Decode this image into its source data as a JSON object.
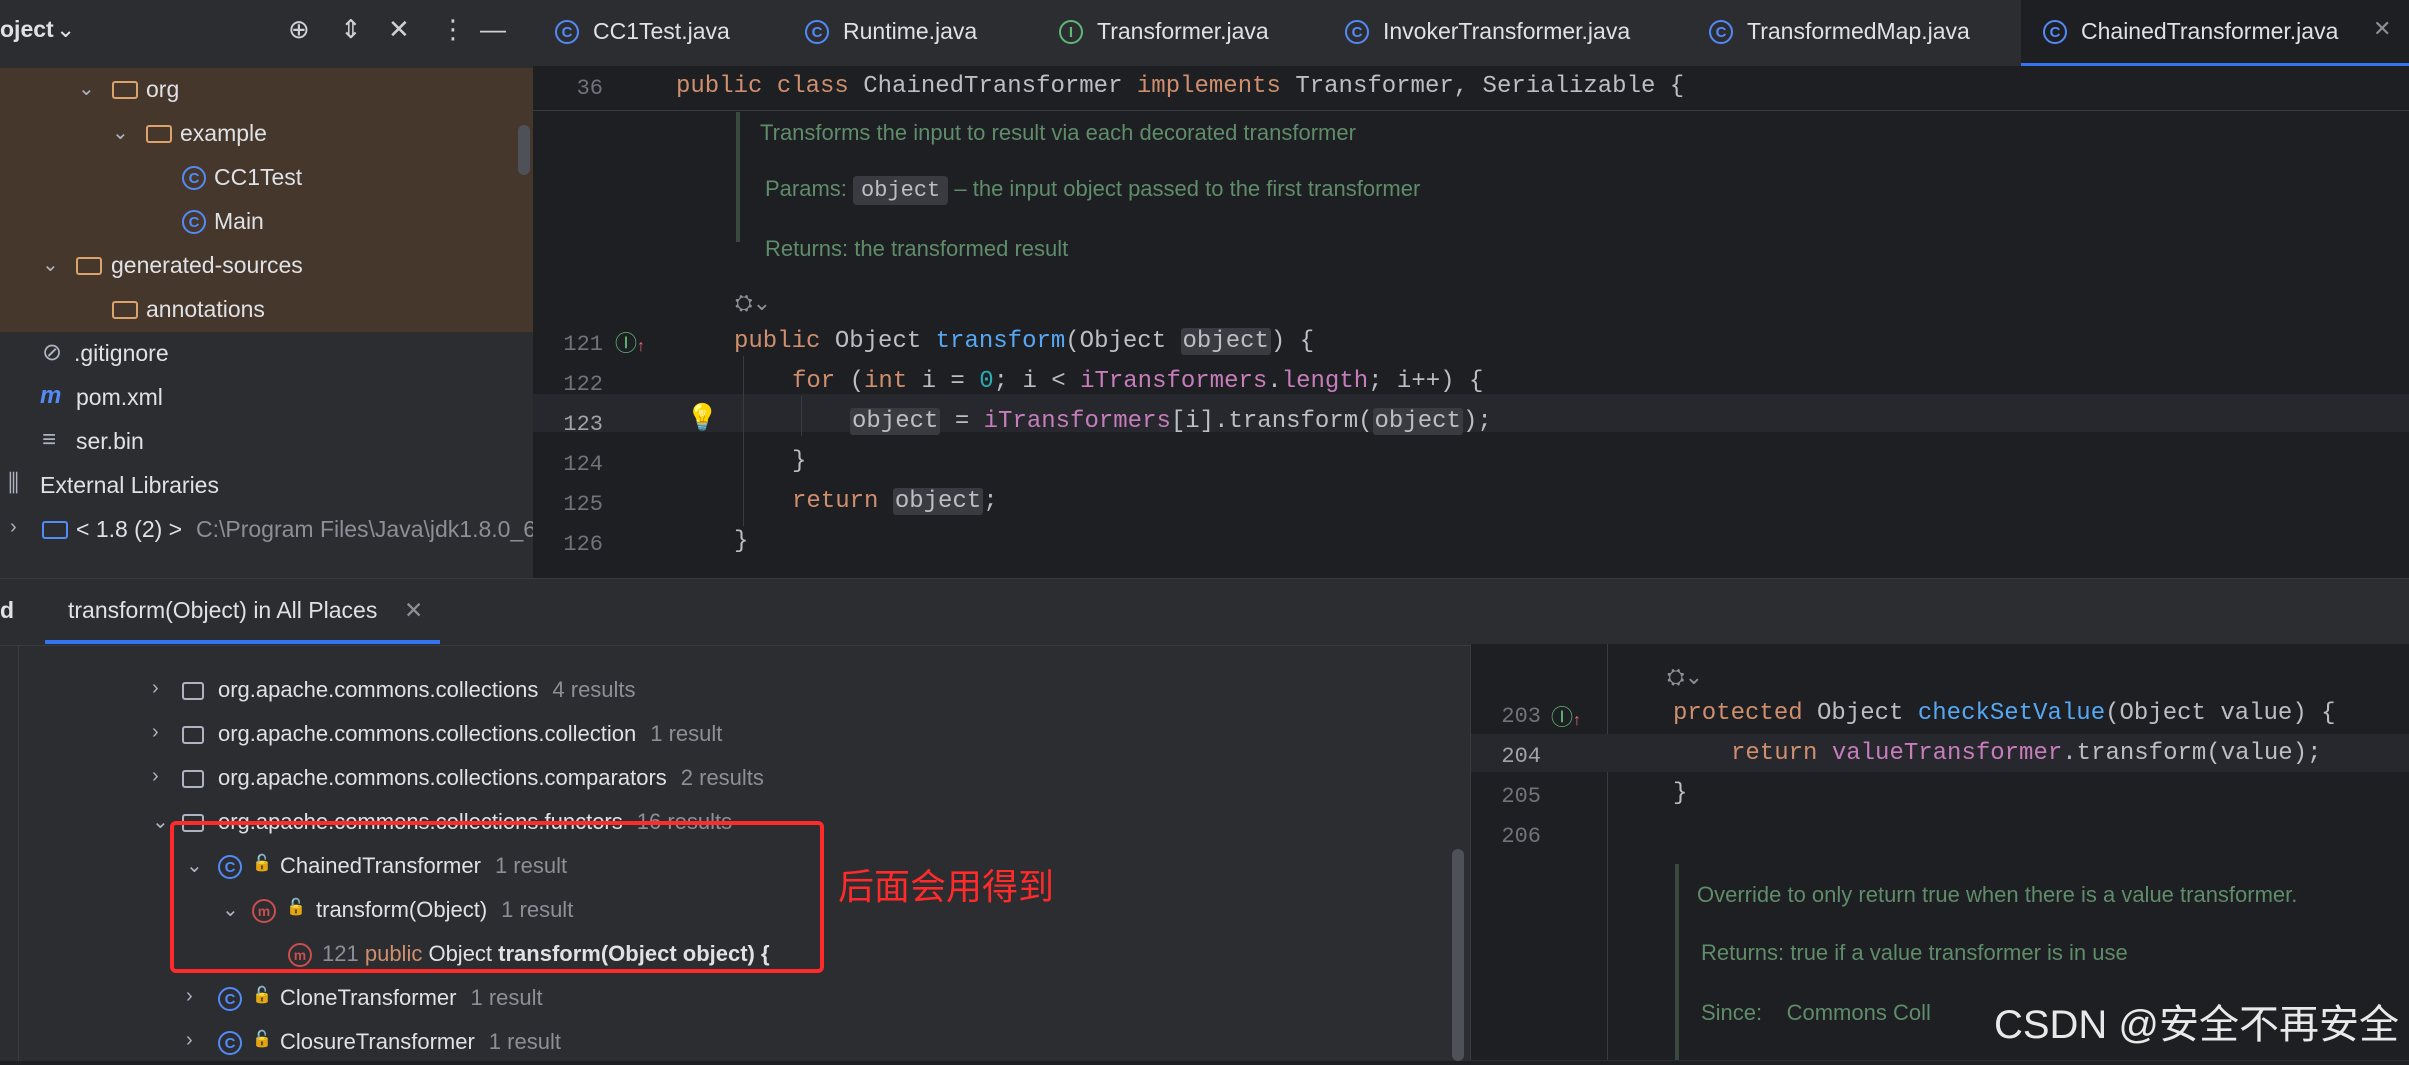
{
  "project": {
    "title": "oject",
    "tree": [
      {
        "label": "org"
      },
      {
        "label": "example"
      },
      {
        "label": "CC1Test"
      },
      {
        "label": "Main"
      },
      {
        "label": "generated-sources"
      },
      {
        "label": "annotations"
      },
      {
        "label": ".gitignore"
      },
      {
        "label": "pom.xml"
      },
      {
        "label": "ser.bin"
      },
      {
        "label": "External Libraries"
      },
      {
        "label": "< 1.8 (2) >",
        "path": "C:\\Program Files\\Java\\jdk1.8.0_6"
      }
    ]
  },
  "tabs": [
    {
      "label": "CC1Test.java",
      "icon": "C"
    },
    {
      "label": "Runtime.java",
      "icon": "C"
    },
    {
      "label": "Transformer.java",
      "icon": "I"
    },
    {
      "label": "InvokerTransformer.java",
      "icon": "C"
    },
    {
      "label": "TransformedMap.java",
      "icon": "C"
    },
    {
      "label": "ChainedTransformer.java",
      "icon": "C"
    }
  ],
  "editor": {
    "line36": "36",
    "class_decl": {
      "kw1": "public class ",
      "name": "ChainedTransformer ",
      "kw2": "implements ",
      "rest": "Transformer, Serializable {"
    },
    "doc": {
      "summary": "Transforms the input to result via each decorated transformer",
      "params_label": "Params:",
      "params_chip": "object",
      "params_text": "– the input object passed to the first transformer",
      "returns": "Returns: the transformed result"
    },
    "lines": [
      {
        "num": "121"
      },
      {
        "num": "122"
      },
      {
        "num": "123"
      },
      {
        "num": "124"
      },
      {
        "num": "125"
      },
      {
        "num": "126"
      }
    ],
    "code": {
      "l121_kw": "public ",
      "l121_ty": "Object ",
      "l121_fn": "transform",
      "l121_p1": "(Object ",
      "l121_var": "object",
      "l121_end": ") {",
      "l122_kw": "for ",
      "l122_a": "(",
      "l122_int": "int ",
      "l122_b": "i = ",
      "l122_zero": "0",
      "l122_c": "; i < ",
      "l122_fld": "iTransformers",
      "l122_d": ".",
      "l122_len": "length",
      "l122_e": "; i++) {",
      "l123_var": "object",
      "l123_a": " = ",
      "l123_fld": "iTransformers",
      "l123_b": "[i].transform(",
      "l123_var2": "object",
      "l123_c": ");",
      "l124": "}",
      "l125_kw": "return ",
      "l125_var": "object",
      "l125_end": ";",
      "l126": "}"
    }
  },
  "find": {
    "side_label": "d",
    "tab_label": "transform(Object) in All Places",
    "results": [
      {
        "label": "org.apache.commons.collections",
        "count": "4 results"
      },
      {
        "label": "org.apache.commons.collections.collection",
        "count": "1 result"
      },
      {
        "label": "org.apache.commons.collections.comparators",
        "count": "2 results"
      },
      {
        "label": "org.apache.commons.collections.functors",
        "count": "16 results"
      },
      {
        "label": "ChainedTransformer",
        "count": "1 result"
      },
      {
        "label": "transform(Object)",
        "count": "1 result"
      },
      {
        "label_num": "121",
        "label_kw": "public",
        "label_ty": "Object",
        "label_bold": "transform(Object object) {"
      },
      {
        "label": "CloneTransformer",
        "count": "1 result"
      },
      {
        "label": "ClosureTransformer",
        "count": "1 result"
      }
    ]
  },
  "preview": {
    "lines": [
      {
        "num": "203"
      },
      {
        "num": "204"
      },
      {
        "num": "205"
      },
      {
        "num": "206"
      }
    ],
    "code": {
      "l203_kw": "protected ",
      "l203_ty": "Object ",
      "l203_fn": "checkSetValue",
      "l203_end": "(Object value) {",
      "l204_kw": "return ",
      "l204_fld": "valueTransformer",
      "l204_a": ".transform(value);",
      "l205": "}"
    },
    "doc": {
      "summary": "Override to only return true when there is a value transformer.",
      "returns": "Returns: true if a value transformer is in use",
      "since_label": "Since:",
      "since_value": "Commons Coll"
    }
  },
  "annotation": {
    "note": "后面会用得到"
  },
  "watermark": "CSDN @安全不再安全"
}
